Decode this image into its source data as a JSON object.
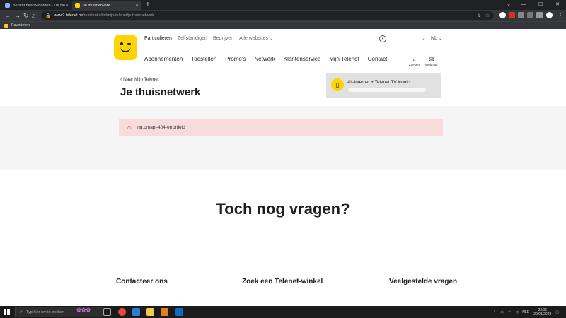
{
  "browser": {
    "tabs": [
      {
        "title": "Bericht beantwoorden - De Netw",
        "active": false
      },
      {
        "title": "Je thuisnetwerk",
        "active": true
      }
    ],
    "new_tab": "+",
    "window_controls": [
      "⌄",
      "—",
      "☐",
      "✕"
    ],
    "url_host": "www2.telenet.be",
    "url_path": "/residential/nl/mijn-telenet/je-thuisnetwerk",
    "bookmarks_folder": "Favorieten"
  },
  "site": {
    "segments": [
      {
        "label": "Particulieren",
        "active": true
      },
      {
        "label": "Zelfstandigen",
        "active": false
      },
      {
        "label": "Bedrijven",
        "active": false
      }
    ],
    "all_websites": "Alle websites",
    "language": "NL",
    "main_nav": [
      "Abonnementen",
      "Toestellen",
      "Promo's",
      "Netwerk",
      "Klantenservice",
      "Mijn Telenet",
      "Contact"
    ],
    "tools": {
      "search": "Zoeken",
      "webmail": "Webmail"
    },
    "breadcrumb_back": "Naar Mijn Telenet",
    "page_title": "Je thuisnetwerk",
    "product_name": "All-Internet + Telenet TV iconic",
    "error_message": "ng.omapi-404-errorfield",
    "faq_title": "Toch nog vragen?",
    "bottom_links": [
      "Contacteer ons",
      "Zoek een Telenet-winkel",
      "Veelgestelde vragen"
    ]
  },
  "taskbar": {
    "search_placeholder": "Typ hier om te zoeken",
    "language": "NLD",
    "time": "23:06",
    "date": "20/01/2023"
  },
  "colors": {
    "brand_yellow": "#ffd400",
    "error_bg": "#f8dcdc",
    "error_icon": "#c62828",
    "section_gray": "#f5f5f5"
  }
}
